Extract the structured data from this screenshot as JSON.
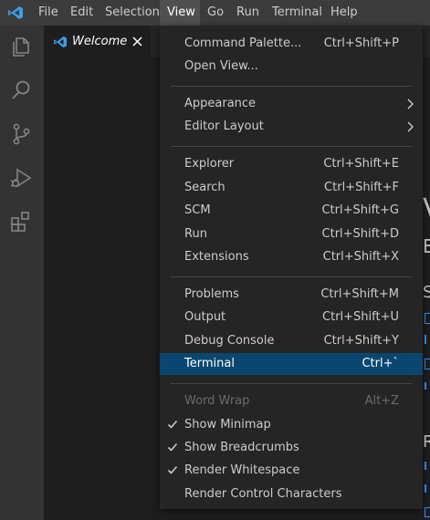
{
  "menubar": {
    "items": [
      "File",
      "Edit",
      "Selection",
      "View",
      "Go",
      "Run",
      "Terminal",
      "Help"
    ],
    "active": "View"
  },
  "activity_bar": {
    "icons": [
      "files-icon",
      "search-icon",
      "source-control-icon",
      "run-debug-icon",
      "extensions-icon"
    ]
  },
  "tab": {
    "label": "Welcome"
  },
  "editor_peek": {
    "chars": [
      "V",
      "E",
      "S",
      "R"
    ]
  },
  "view_menu": {
    "items": [
      {
        "label": "Command Palette...",
        "shortcut": "Ctrl+Shift+P"
      },
      {
        "label": "Open View...",
        "shortcut": ""
      },
      {
        "label": "Appearance",
        "shortcut": "",
        "submenu": true
      },
      {
        "label": "Editor Layout",
        "shortcut": "",
        "submenu": true
      },
      {
        "label": "Explorer",
        "shortcut": "Ctrl+Shift+E"
      },
      {
        "label": "Search",
        "shortcut": "Ctrl+Shift+F"
      },
      {
        "label": "SCM",
        "shortcut": "Ctrl+Shift+G"
      },
      {
        "label": "Run",
        "shortcut": "Ctrl+Shift+D"
      },
      {
        "label": "Extensions",
        "shortcut": "Ctrl+Shift+X"
      },
      {
        "label": "Problems",
        "shortcut": "Ctrl+Shift+M"
      },
      {
        "label": "Output",
        "shortcut": "Ctrl+Shift+U"
      },
      {
        "label": "Debug Console",
        "shortcut": "Ctrl+Shift+Y"
      },
      {
        "label": "Terminal",
        "shortcut": "Ctrl+`",
        "selected": true
      },
      {
        "label": "Word Wrap",
        "shortcut": "Alt+Z",
        "disabled": true
      },
      {
        "label": "Show Minimap",
        "shortcut": "",
        "checked": true
      },
      {
        "label": "Show Breadcrumbs",
        "shortcut": "",
        "checked": true
      },
      {
        "label": "Render Whitespace",
        "shortcut": "",
        "checked": true
      },
      {
        "label": "Render Control Characters",
        "shortcut": ""
      }
    ]
  },
  "colors": {
    "titlebar": "#3c3c3c",
    "activitybar": "#333333",
    "editor": "#1e1e1e",
    "menu_bg": "#252526",
    "selection": "#094771",
    "accent": "#007acc"
  }
}
